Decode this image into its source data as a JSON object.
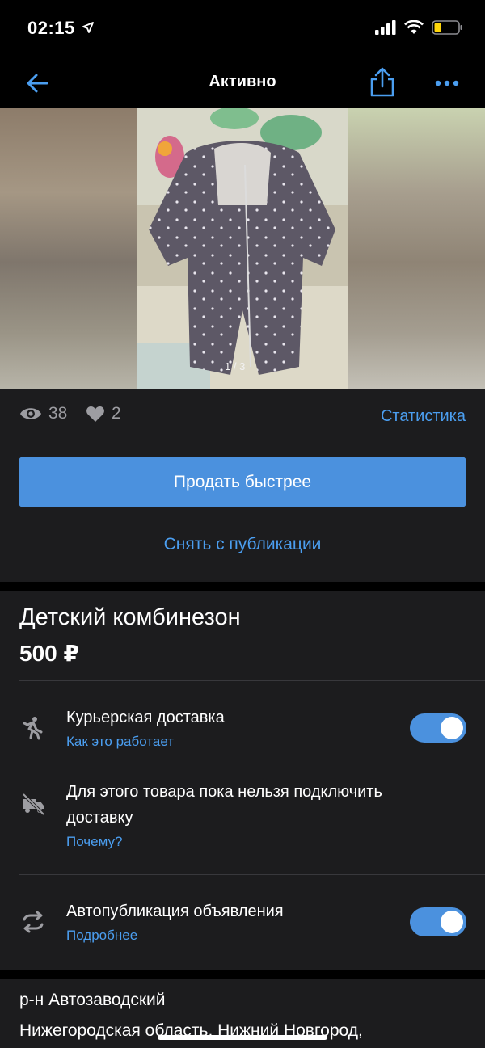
{
  "status_bar": {
    "time": "02:15"
  },
  "nav": {
    "title": "Активно"
  },
  "gallery": {
    "counter": "1 / 3"
  },
  "stats": {
    "views": "38",
    "likes": "2",
    "link": "Статистика"
  },
  "actions": {
    "sell_faster": "Продать быстрее",
    "unpublish": "Снять с публикации"
  },
  "listing": {
    "title": "Детский комбинезон",
    "price": "500 ₽"
  },
  "options": [
    {
      "title": "Курьерская доставка",
      "link": "Как это работает",
      "icon": "courier-icon",
      "toggle": "on"
    },
    {
      "title": "Для этого товара пока нельзя подключить доставку",
      "link": "Почему?",
      "icon": "no-delivery-icon"
    },
    {
      "title": "Автопубликация объявления",
      "link": "Подробнее",
      "icon": "autopublish-icon",
      "toggle": "on"
    }
  ],
  "location": {
    "district": "р-н Автозаводский",
    "region": "Нижегородская область, Нижний Новгород,"
  },
  "colors": {
    "accent": "#4b91de",
    "link": "#4b9ef0",
    "background": "#1c1c1e"
  }
}
